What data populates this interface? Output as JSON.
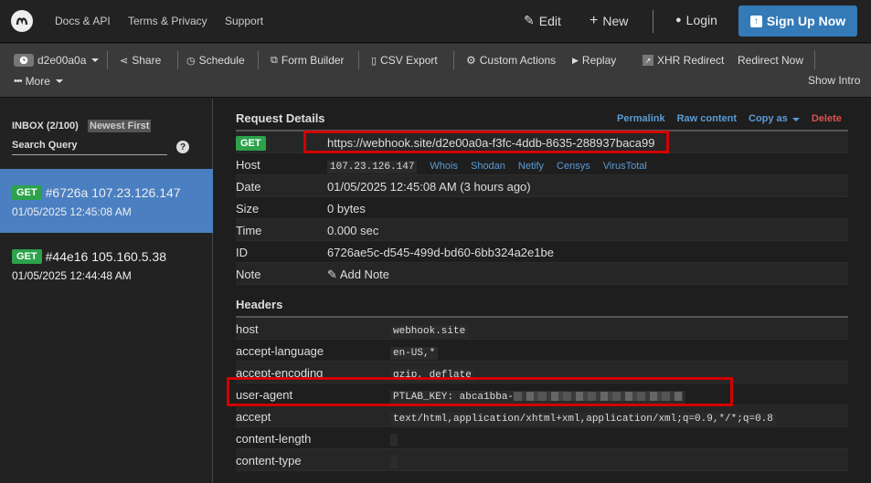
{
  "nav": {
    "links": [
      "Docs & API",
      "Terms & Privacy",
      "Support"
    ],
    "edit": "Edit",
    "new": "New",
    "login": "Login",
    "signup": "Sign Up Now"
  },
  "toolbar": {
    "token": "d2e00a0a",
    "share": "Share",
    "schedule": "Schedule",
    "form_builder": "Form Builder",
    "csv_export": "CSV Export",
    "custom_actions": "Custom Actions",
    "replay": "Replay",
    "xhr_redirect": "XHR Redirect",
    "redirect_now": "Redirect Now",
    "more": "More",
    "show_intro": "Show Intro"
  },
  "sidebar": {
    "inbox": "INBOX (2/100)",
    "sort": "Newest First",
    "search_placeholder": "Search Query",
    "help": "?",
    "requests": [
      {
        "method": "GET",
        "title": "#6726a 107.23.126.147",
        "time": "01/05/2025 12:45:08 AM",
        "active": true
      },
      {
        "method": "GET",
        "title": "#44e16 105.160.5.38",
        "time": "01/05/2025 12:44:48 AM",
        "active": false
      }
    ]
  },
  "details": {
    "title": "Request Details",
    "actions": {
      "permalink": "Permalink",
      "raw": "Raw content",
      "copy": "Copy as",
      "delete": "Delete"
    },
    "method": "GET",
    "url": "https://webhook.site/d2e00a0a-f3fc-4ddb-8635-288937baca99",
    "host_label": "Host",
    "host": "107.23.126.147",
    "host_links": [
      "Whois",
      "Shodan",
      "Netify",
      "Censys",
      "VirusTotal"
    ],
    "date_label": "Date",
    "date": "01/05/2025 12:45:08 AM (3 hours ago)",
    "size_label": "Size",
    "size": "0 bytes",
    "time_label": "Time",
    "time": "0.000 sec",
    "id_label": "ID",
    "id": "6726ae5c-d545-499d-bd60-6bb324a2e1be",
    "note_label": "Note",
    "note_action": "Add Note"
  },
  "headers": {
    "title": "Headers",
    "rows": [
      {
        "key": "host",
        "value": "webhook.site"
      },
      {
        "key": "accept-language",
        "value": "en-US,*"
      },
      {
        "key": "accept-encoding",
        "value": "gzip, deflate"
      },
      {
        "key": "user-agent",
        "value": "PTLAB_KEY: abca1bba-"
      },
      {
        "key": "accept",
        "value": "text/html,application/xhtml+xml,application/xml;q=0.9,*/*;q=0.8"
      },
      {
        "key": "content-length",
        "value": ""
      },
      {
        "key": "content-type",
        "value": ""
      }
    ]
  },
  "colors": {
    "accent": "#337ab7",
    "get_badge": "#2ca24b",
    "highlight": "#d20000",
    "active_item": "#4a7fc1"
  }
}
